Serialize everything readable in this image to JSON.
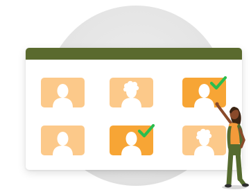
{
  "colors": {
    "titlebar": "#5a6a2e",
    "tile_light": "#fcc98a",
    "tile_selected": "#f7a535",
    "silhouette": "#ffffff",
    "check": "#2bbd4e",
    "background_circle": "#e4e4e4"
  },
  "tiles": [
    {
      "id": "tile-1",
      "hair": "short",
      "selected": false
    },
    {
      "id": "tile-2",
      "hair": "curly",
      "selected": false
    },
    {
      "id": "tile-3",
      "hair": "short",
      "selected": true
    },
    {
      "id": "tile-4",
      "hair": "short",
      "selected": false
    },
    {
      "id": "tile-5",
      "hair": "short",
      "selected": true
    },
    {
      "id": "tile-6",
      "hair": "curly",
      "selected": false
    }
  ],
  "icons": {
    "check": "checkmark-icon",
    "avatar": "user-silhouette-icon",
    "person": "woman-pointing-illustration"
  }
}
